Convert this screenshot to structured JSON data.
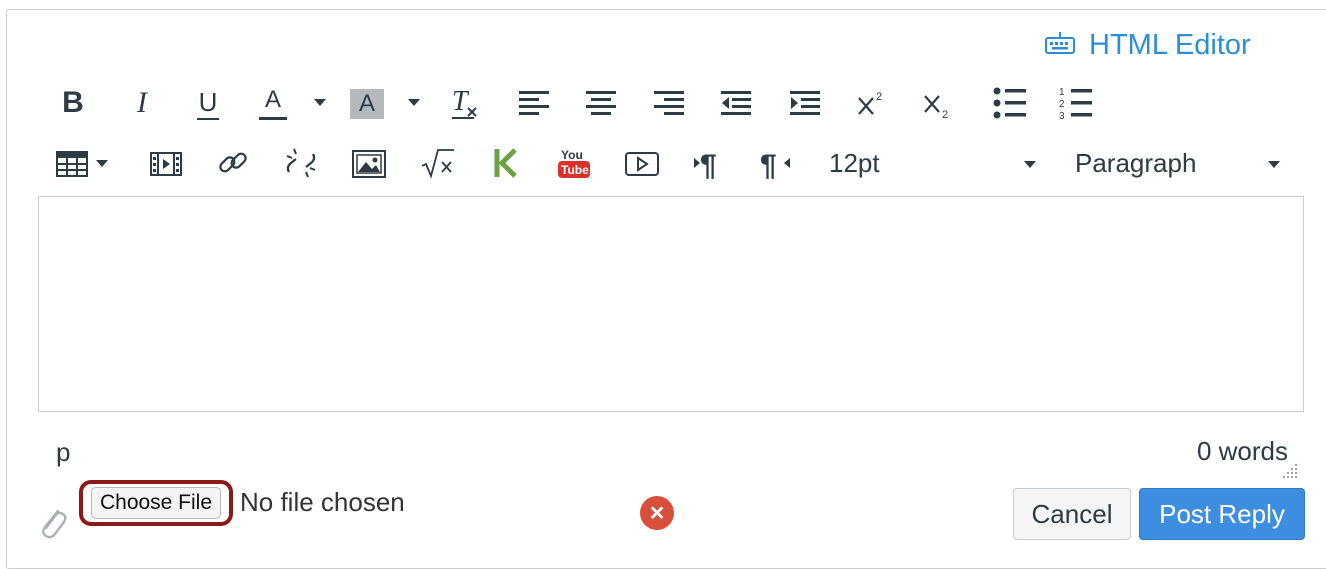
{
  "header": {
    "html_editor_label": "HTML Editor"
  },
  "toolbar": {
    "bold": "B",
    "italic": "I",
    "underline": "U",
    "font_color": "A",
    "background_color": "A",
    "font_size_value": "12pt",
    "format_value": "Paragraph"
  },
  "status": {
    "path": "p",
    "word_count": "0 words"
  },
  "attachment": {
    "choose_label": "Choose File",
    "no_file_text": "No file chosen"
  },
  "actions": {
    "cancel_label": "Cancel",
    "post_label": "Post Reply"
  },
  "colors": {
    "accent": "#2c8ed6",
    "primary_button": "#3d8ee0",
    "highlight_ring": "#8b1a1a",
    "remove_icon": "#d8503c"
  }
}
